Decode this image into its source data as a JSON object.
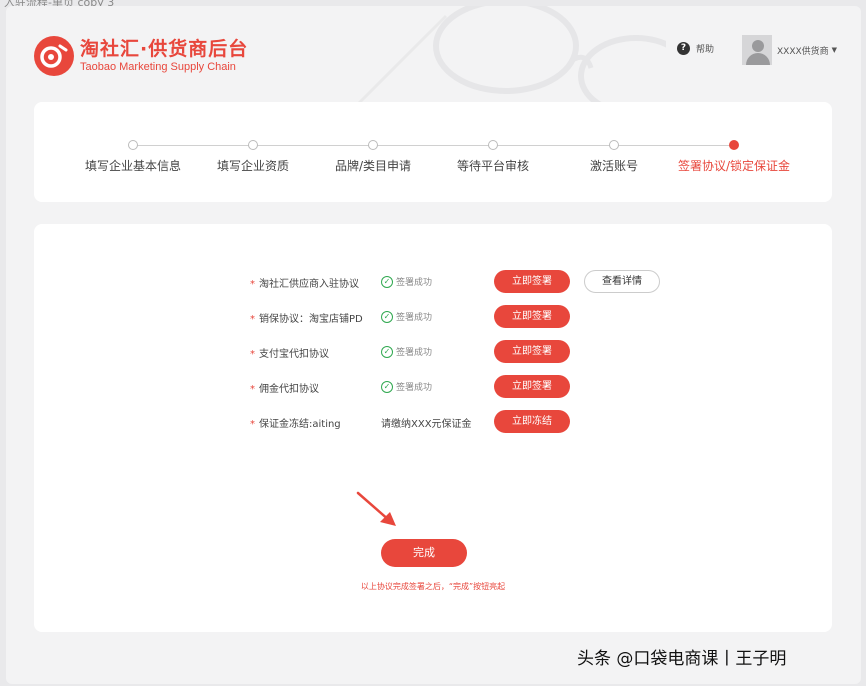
{
  "tab_caption": "入驻流程-单页 copy 3",
  "header": {
    "logo_title": "淘社汇·供货商后台",
    "logo_subtitle": "Taobao Marketing Supply Chain",
    "help_label": "帮助",
    "user_name": "XXXX供货商"
  },
  "steps": [
    {
      "label": "填写企业基本信息",
      "active": false
    },
    {
      "label": "填写企业资质",
      "active": false
    },
    {
      "label": "品牌/类目申请",
      "active": false
    },
    {
      "label": "等待平台审核",
      "active": false
    },
    {
      "label": "激活账号",
      "active": false
    },
    {
      "label": "签署协议/锁定保证金",
      "active": true
    }
  ],
  "agreements": [
    {
      "star": "*",
      "name": "淘社汇供应商入驻协议",
      "status": "签署成功",
      "status_ok": true,
      "action": "立即签署",
      "secondary_action": "查看详情"
    },
    {
      "star": "*",
      "name": "销保协议：淘宝店铺PD",
      "status": "签署成功",
      "status_ok": true,
      "action": "立即签署"
    },
    {
      "star": "*",
      "name": "支付宝代扣协议",
      "status": "签署成功",
      "status_ok": true,
      "action": "立即签署"
    },
    {
      "star": "*",
      "name": "佣金代扣协议",
      "status": "签署成功",
      "status_ok": true,
      "action": "立即签署"
    },
    {
      "star": "*",
      "name": "保证金冻结:aiting",
      "status": "请缴纳XXX元保证金",
      "status_ok": false,
      "action": "立即冻结"
    }
  ],
  "done_button": "完成",
  "done_hint": "以上协议完成签署之后，“完成”按钮亮起",
  "watermark": "头条 @口袋电商课丨王子明",
  "colors": {
    "accent": "#e8473c",
    "success": "#2fa84f"
  }
}
